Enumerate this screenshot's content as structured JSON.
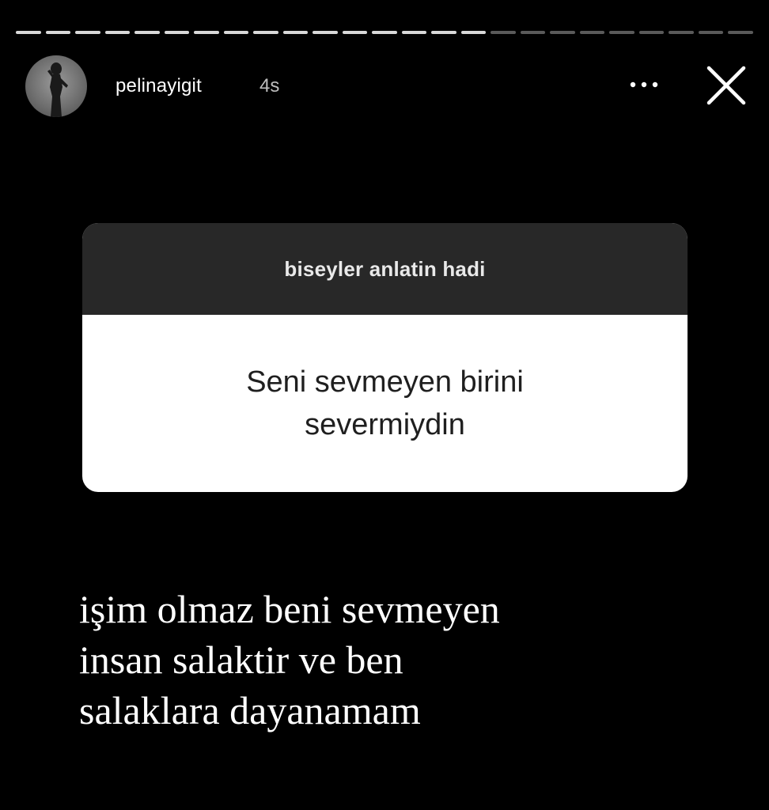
{
  "story": {
    "progress": {
      "segments_total": 25,
      "segments_viewed": 16
    },
    "author": {
      "username": "pelinayigit",
      "timestamp": "4s"
    },
    "controls": {
      "more_icon": "more-horizontal-icon",
      "close_icon": "close-icon"
    },
    "question_sticker": {
      "prompt": "biseyler anlatin hadi",
      "question_lines": [
        "Seni sevmeyen birini",
        "severmiydin"
      ]
    },
    "reply_text_lines": [
      "işim olmaz beni sevmeyen",
      "insan salaktir ve ben",
      "salaklara dayanamam"
    ]
  },
  "colors": {
    "background": "#000000",
    "progress_viewed": "#d8d8d8",
    "progress_pending": "#5a5a5a",
    "sticker_header": "#282828",
    "sticker_body": "#ffffff"
  }
}
